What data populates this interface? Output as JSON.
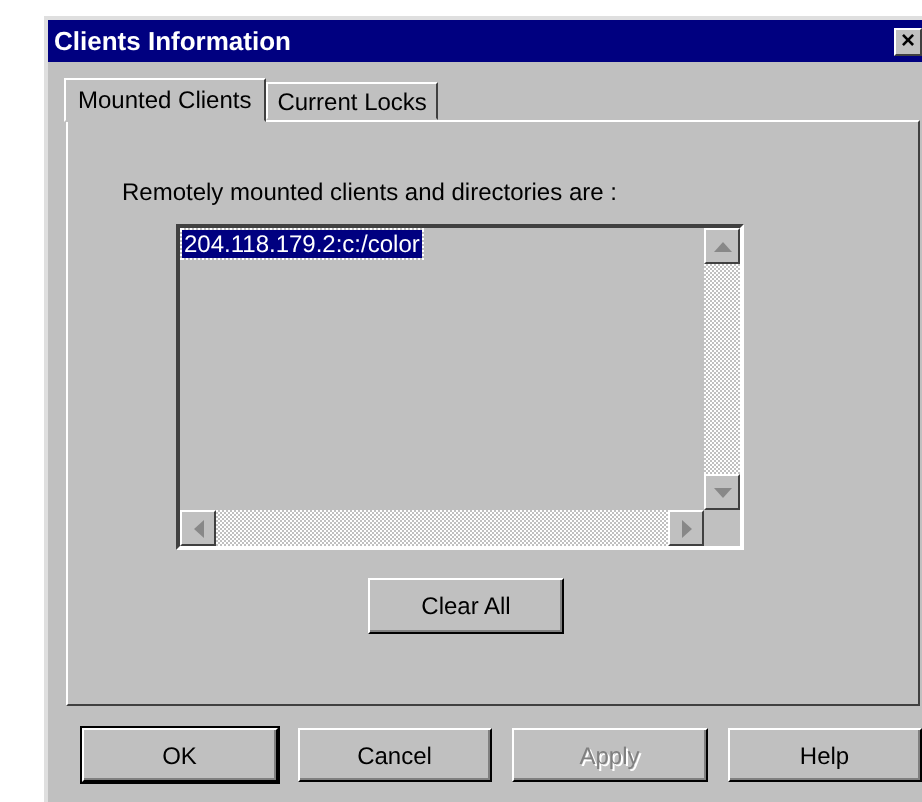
{
  "window": {
    "title": "Clients Information",
    "close": "×"
  },
  "tabs": [
    {
      "label": "Mounted Clients",
      "selected": true
    },
    {
      "label": "Current Locks",
      "selected": false
    }
  ],
  "label": "Remotely mounted clients and directories are :",
  "list": {
    "items": [
      {
        "text": "204.118.179.2:c:/color",
        "selected": true
      }
    ]
  },
  "clear_button": "Clear All",
  "buttons": [
    {
      "label": "OK",
      "default": true,
      "disabled": false
    },
    {
      "label": "Cancel",
      "default": false,
      "disabled": false
    },
    {
      "label": "Apply",
      "default": false,
      "disabled": true
    },
    {
      "label": "Help",
      "default": false,
      "disabled": false
    }
  ]
}
